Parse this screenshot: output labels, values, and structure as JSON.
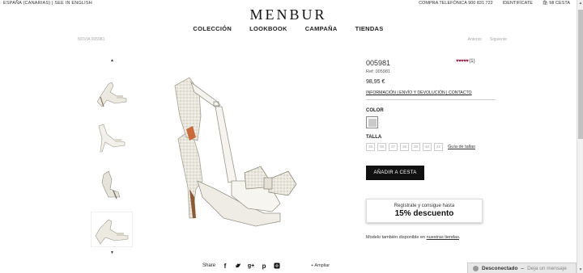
{
  "topbar": {
    "region": "ESPAÑA (CANARIAS) | SEE IN ENGLISH",
    "phone": "COMPRA TELEFÓNICA 900 831 722",
    "login": "IDENTIFÍCATE",
    "cart": "MI CESTA"
  },
  "brand": {
    "logo": "MENBUR"
  },
  "nav": {
    "items": [
      "COLECCIÓN",
      "LOOKBOOK",
      "CAMPAÑA",
      "TIENDAS"
    ]
  },
  "breadcrumb": "NOVIA  005981",
  "pager": {
    "prev": "Anterior",
    "next": "Siguiente"
  },
  "product": {
    "code": "005981",
    "ref": "Ref: 005981",
    "price": "98,95 €",
    "rating_count": "(1)",
    "rating_stars": "♥♥♥♥♥",
    "links": {
      "info": "INFORMACIÓN",
      "shipping": "ENVÍO Y DEVOLUCIÓN",
      "contact": "CONTACTO"
    },
    "color_label": "COLOR",
    "size_label": "TALLA",
    "sizes": [
      "35",
      "36",
      "37",
      "38",
      "39",
      "40",
      "41"
    ],
    "size_guide": "Guía de tallas",
    "add_to_cart": "AÑADIR A CESTA",
    "availability_prefix": "Modelo también disponible en ",
    "availability_link": "nuestras tiendas",
    "availability_suffix": "."
  },
  "promo": {
    "line1": "Regístrate y consigue hasta",
    "line2": "15% descuento"
  },
  "share": {
    "label": "Share",
    "zoom": "+ Ampliar"
  },
  "chat": {
    "status": "Desconectado",
    "action": "Deja un mensaje"
  },
  "colors": {
    "rating": "#9b1d40",
    "button": "#111111"
  }
}
